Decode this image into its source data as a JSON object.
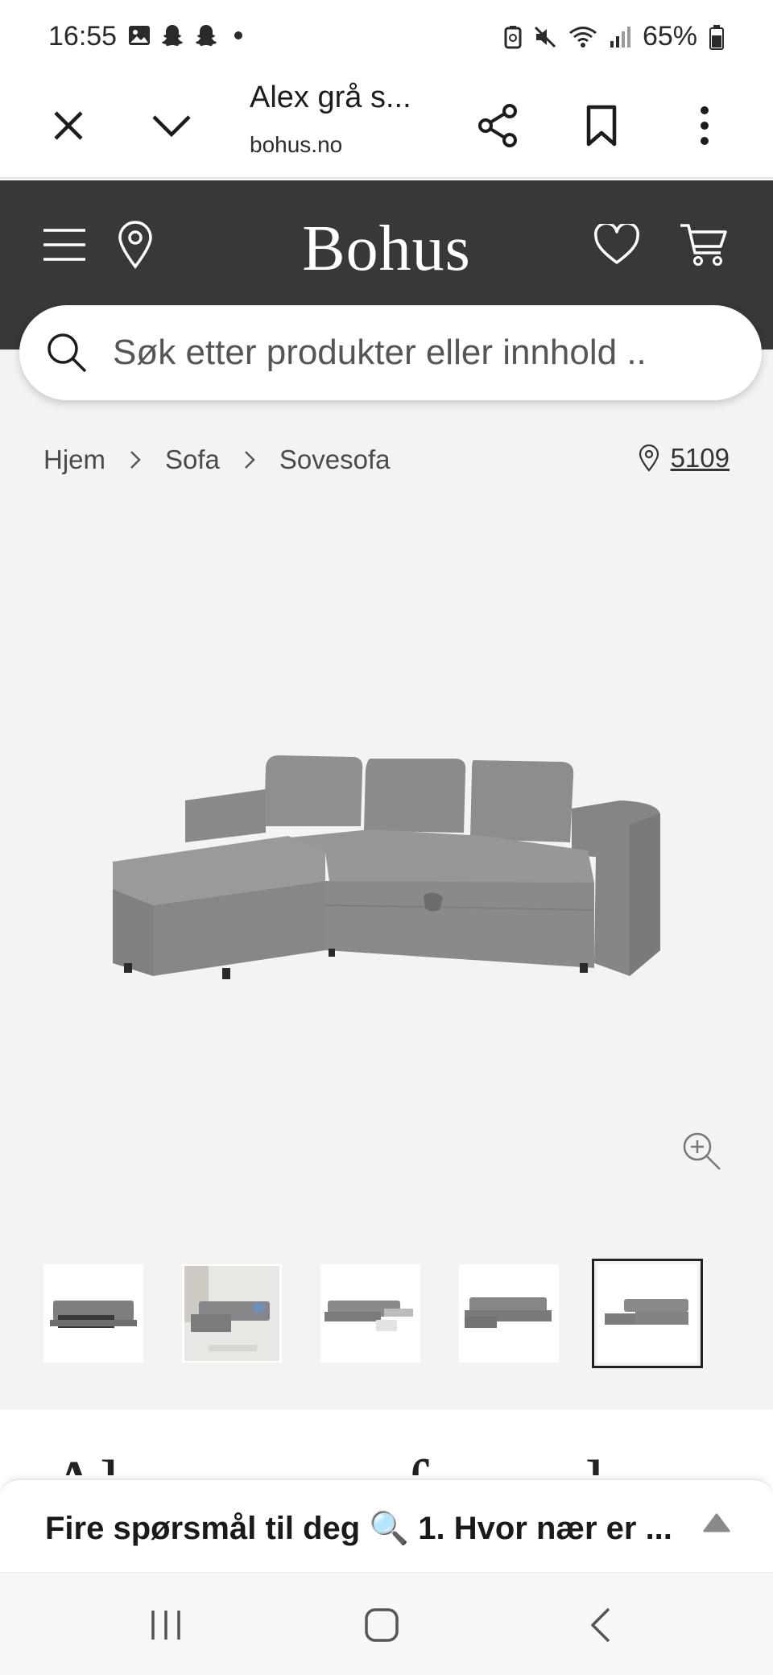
{
  "status_bar": {
    "time": "16:55",
    "battery": "65%",
    "icons_left": [
      "gallery-icon",
      "snapchat-icon",
      "snapchat-icon",
      "dot-icon"
    ],
    "icons_right": [
      "battery-saver-icon",
      "mute-icon",
      "wifi-icon",
      "signal-icon",
      "battery-icon"
    ]
  },
  "toolbar": {
    "title": "Alex grå s...",
    "url": "bohus.no"
  },
  "site": {
    "logo": "Bohus",
    "header_color": "#38383a"
  },
  "search": {
    "placeholder": "Søk etter produkter eller innhold .."
  },
  "breadcrumb": {
    "items": [
      "Hjem",
      "Sofa",
      "Sovesofa"
    ]
  },
  "store": {
    "code": "5109"
  },
  "gallery": {
    "thumbnail_count": 5,
    "active_index": 4
  },
  "below_fold": {
    "title_fragment": "Alex sovesofa med sjeselong"
  },
  "banner": {
    "text": "Fire spørsmål til deg 🔍 1. Hvor nær er ..."
  },
  "colors": {
    "page_bg": "#f4f3f1",
    "header": "#38383a",
    "sofa": "#8d8d8f"
  }
}
